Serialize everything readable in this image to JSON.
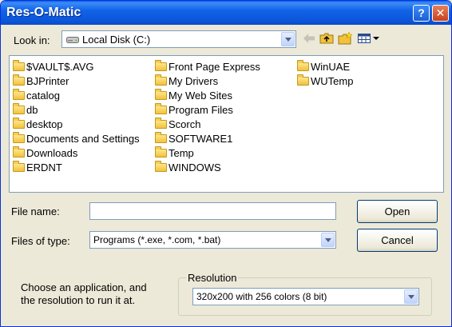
{
  "window": {
    "title": "Res-O-Matic",
    "help_label": "?",
    "close_label": "✕"
  },
  "look_in": {
    "label": "Look in:",
    "value": "Local Disk (C:)"
  },
  "toolbar": {
    "icons": [
      "back-icon",
      "up-folder-icon",
      "new-folder-icon",
      "view-menu-icon"
    ]
  },
  "files": {
    "col1": [
      "$VAULT$.AVG",
      "BJPrinter",
      "catalog",
      "db",
      "desktop",
      "Documents and Settings",
      "Downloads",
      "ERDNT"
    ],
    "col2": [
      "Front Page Express",
      "My Drivers",
      "My Web Sites",
      "Program Files",
      "Scorch",
      "SOFTWARE1",
      "Temp",
      "WINDOWS"
    ],
    "col3": [
      "WinUAE",
      "WUTemp"
    ]
  },
  "file_name": {
    "label": "File name:",
    "value": ""
  },
  "file_type": {
    "label": "Files of type:",
    "value": "Programs (*.exe, *.com, *.bat)"
  },
  "buttons": {
    "open": "Open",
    "cancel": "Cancel"
  },
  "hint": {
    "line1": "Choose an application, and",
    "line2": "the resolution to run it at."
  },
  "resolution": {
    "label": "Resolution",
    "value": "320x200 with 256 colors (8 bit)"
  },
  "colors": {
    "titlebar": "#0b55d8",
    "dialog_bg": "#ece9d8",
    "field_border": "#7f9db9",
    "folder": "#f2c23c"
  }
}
